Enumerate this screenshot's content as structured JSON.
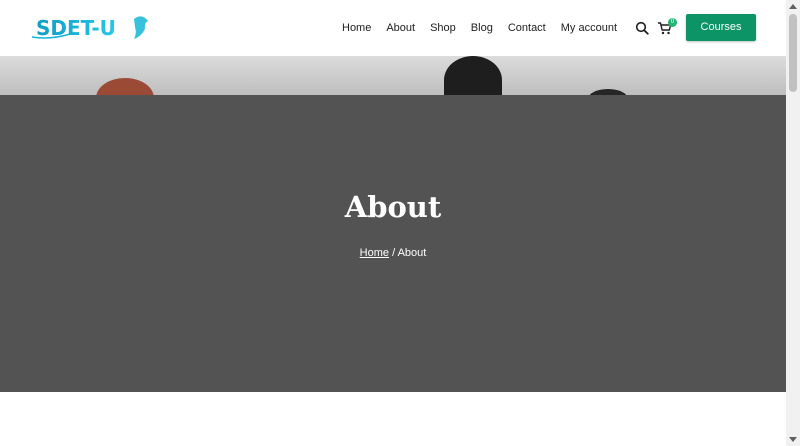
{
  "header": {
    "logo_text": "SDET-U",
    "nav": [
      "Home",
      "About",
      "Shop",
      "Blog",
      "Contact",
      "My account"
    ],
    "cart_count": "0",
    "cta_label": "Courses"
  },
  "hero": {
    "title": "About",
    "breadcrumb": {
      "home": "Home",
      "separator": " / ",
      "current": "About"
    }
  },
  "colors": {
    "brand": "#16b6d6",
    "cta": "#0d9466",
    "hero_overlay": "#535353"
  },
  "icons": [
    "search-icon",
    "cart-icon"
  ]
}
